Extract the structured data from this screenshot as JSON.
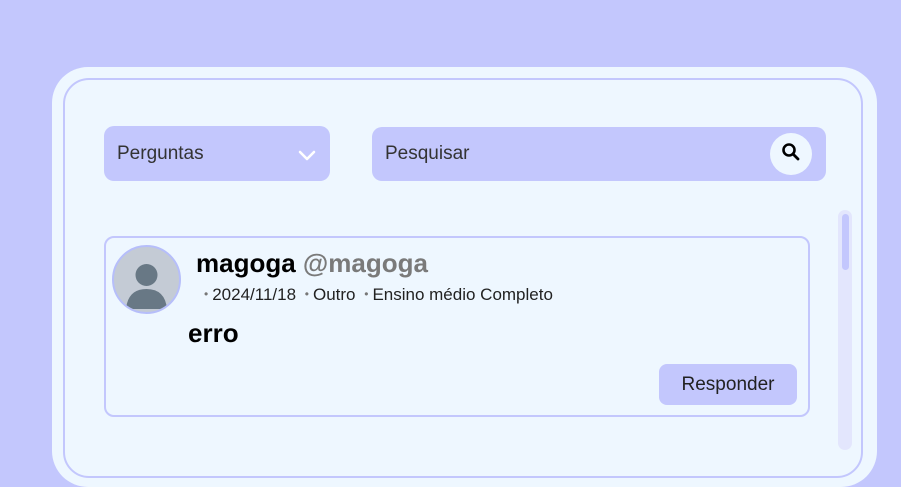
{
  "filter": {
    "selected": "Perguntas",
    "icon": "chevron-down-icon"
  },
  "search": {
    "placeholder": "Pesquisar",
    "value": "",
    "icon": "search-icon"
  },
  "post": {
    "author_name": "magoga",
    "author_handle": "@magoga",
    "date": "2024/11/18",
    "gender": "Outro",
    "education": "Ensino médio Completo",
    "title": "erro",
    "reply_label": "Responder",
    "avatar_icon": "user-avatar-icon"
  },
  "colors": {
    "background": "#c3c7fd",
    "panel": "#eef7ff",
    "accent": "#c3c7fd"
  }
}
